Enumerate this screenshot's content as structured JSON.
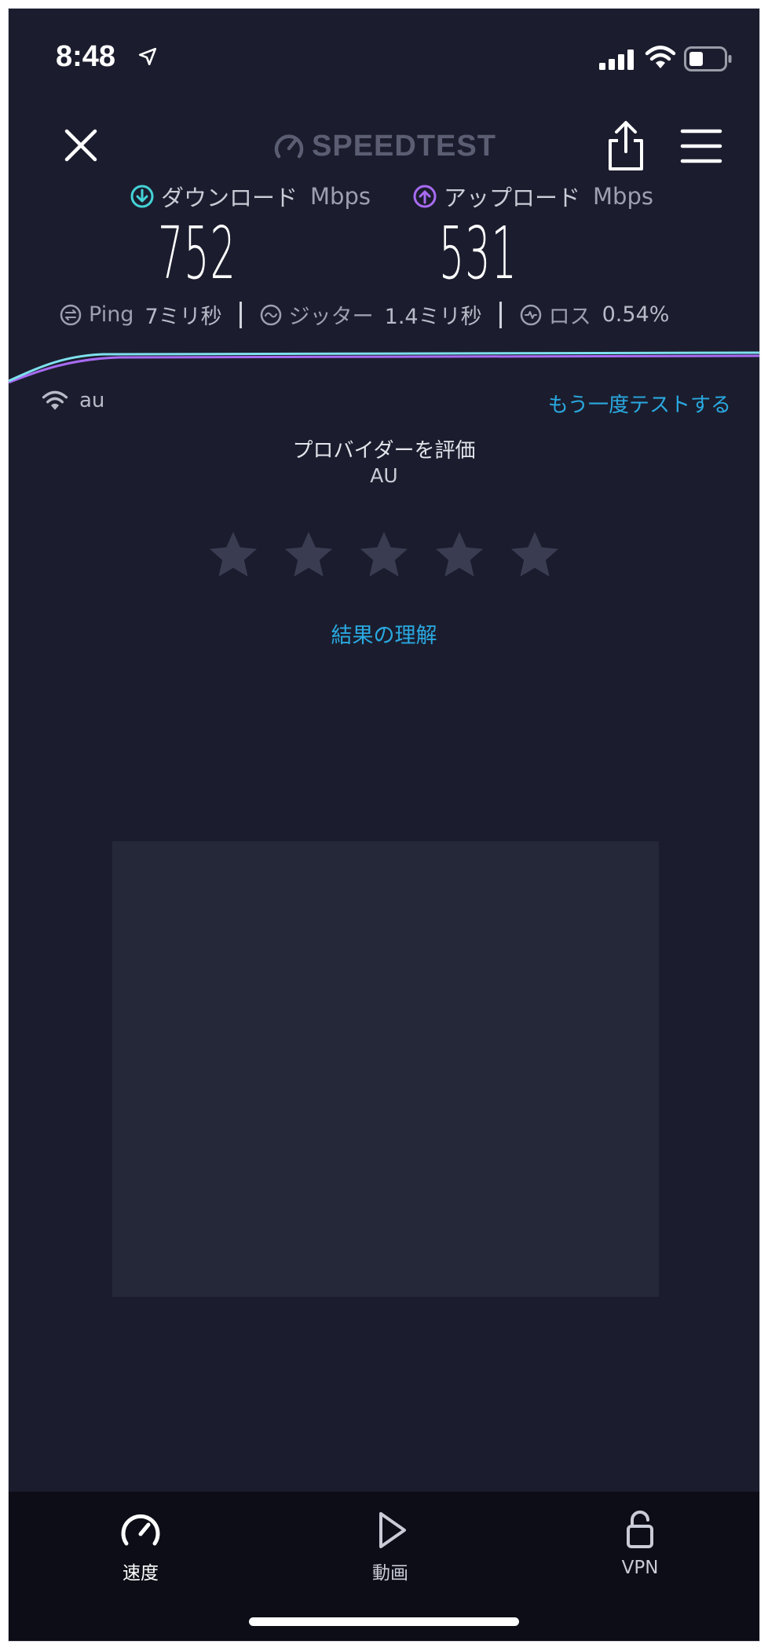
{
  "status_bar": {
    "time": "8:48"
  },
  "header": {
    "logo_text": "SPEEDTEST"
  },
  "download": {
    "label": "ダウンロード",
    "unit": "Mbps",
    "value": "752"
  },
  "upload": {
    "label": "アップロード",
    "unit": "Mbps",
    "value": "531"
  },
  "stats": {
    "ping_label": "Ping",
    "ping_value": "7ミリ秒",
    "jitter_label": "ジッター",
    "jitter_value": "1.4ミリ秒",
    "loss_label": "ロス",
    "loss_value": "0.54%"
  },
  "network": {
    "name": "au",
    "retest_label": "もう一度テストする"
  },
  "rating": {
    "title": "プロバイダーを評価",
    "isp": "AU",
    "stars_total": 5,
    "stars_selected": 0
  },
  "learn_label": "結果の理解",
  "tabs": [
    {
      "label": "速度",
      "icon": "speedometer-icon",
      "active": true
    },
    {
      "label": "動画",
      "icon": "play-icon",
      "active": false
    },
    {
      "label": "VPN",
      "icon": "lock-open-icon",
      "active": false
    }
  ],
  "colors": {
    "background": "#1b1d2e",
    "accent": "#2aa9e0",
    "download": "#44d3d6",
    "upload": "#a86bf2",
    "tabbar": "#0c0d16"
  }
}
